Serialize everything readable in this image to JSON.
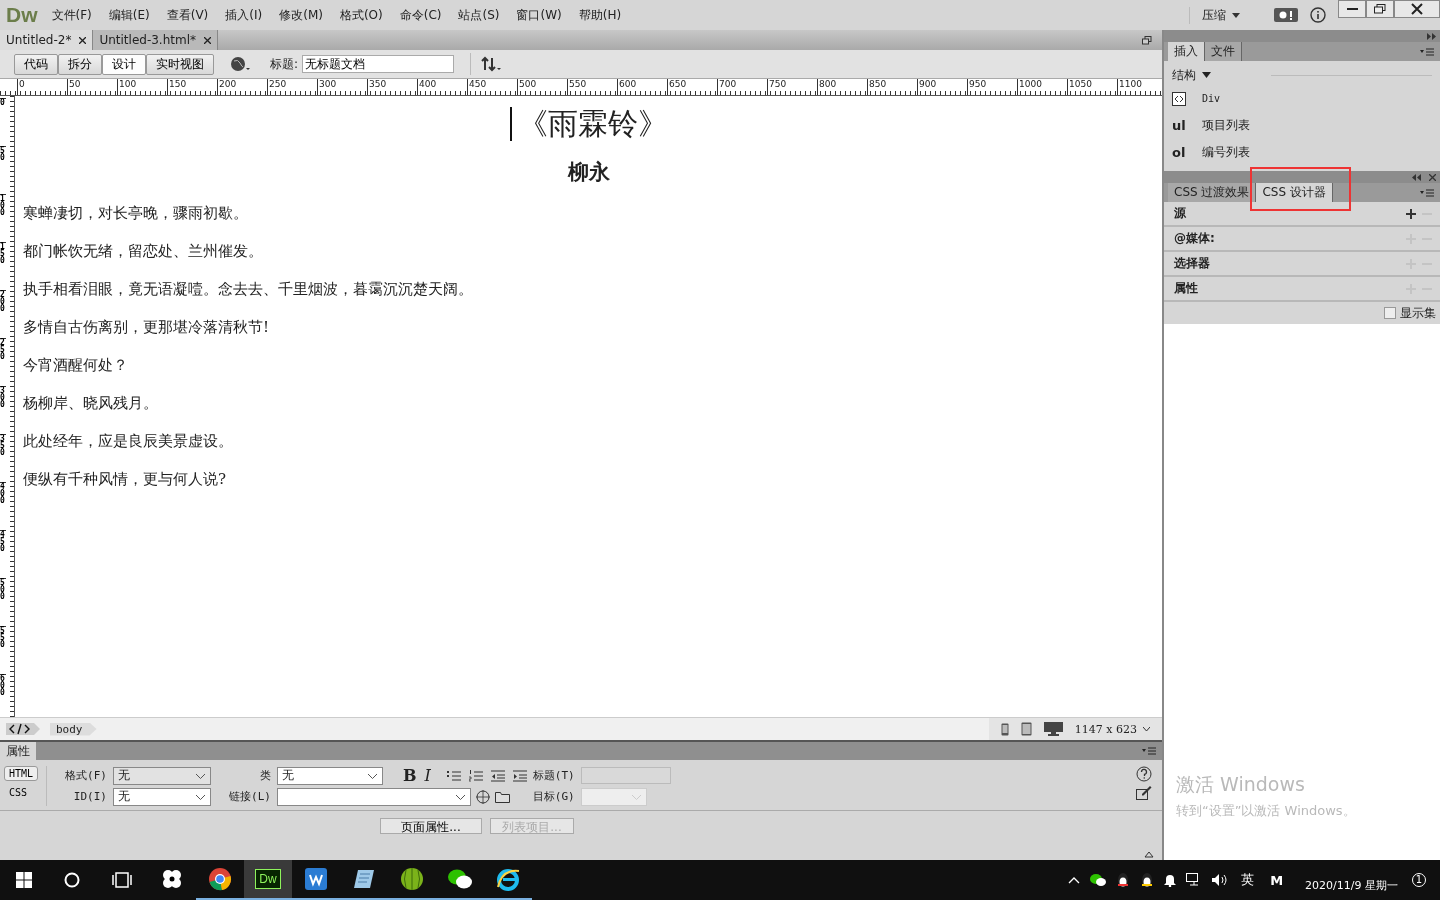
{
  "app": {
    "logo": "Dw",
    "menu": [
      "文件(F)",
      "编辑(E)",
      "查看(V)",
      "插入(I)",
      "修改(M)",
      "格式(O)",
      "命令(C)",
      "站点(S)",
      "窗口(W)",
      "帮助(H)"
    ],
    "workspace": "压缩"
  },
  "doc_tabs": [
    {
      "label": "Untitled-2*",
      "selected": true
    },
    {
      "label": "Untitled-3.html*",
      "selected": false
    }
  ],
  "toolbar": {
    "views": [
      {
        "label": "代码",
        "selected": false
      },
      {
        "label": "拆分",
        "selected": false
      },
      {
        "label": "设计",
        "selected": true
      },
      {
        "label": "实时视图",
        "selected": false
      }
    ],
    "title_label": "标题:",
    "title_value": "无标题文档"
  },
  "ruler": {
    "horizontal": [
      "0",
      "50",
      "100",
      "150",
      "200",
      "250",
      "300",
      "350",
      "400",
      "450",
      "500",
      "550",
      "600",
      "650",
      "700",
      "750",
      "800",
      "850",
      "900",
      "950",
      "1000",
      "1050",
      "1100"
    ],
    "vertical": [
      "0",
      "50",
      "100",
      "150",
      "200",
      "250",
      "300",
      "350",
      "400",
      "450",
      "500",
      "550",
      "600"
    ]
  },
  "document": {
    "title": "《雨霖铃》",
    "author": "柳永",
    "lines": [
      "寒蝉凄切，对长亭晚，骤雨初歇。",
      "都门帐饮无绪，留恋处、兰州催发。",
      "执手相看泪眼，竟无语凝噎。念去去、千里烟波，暮霭沉沉楚天阔。",
      "多情自古伤离别，更那堪冷落清秋节!",
      "今宵酒醒何处？",
      "杨柳岸、晓风残月。",
      "此处经年，应是良辰美景虚设。",
      "便纵有千种风情，更与何人说?"
    ]
  },
  "status_bar": {
    "tag": "body",
    "size": "1147 x 623"
  },
  "properties": {
    "title": "属性",
    "modes": [
      {
        "label": "HTML",
        "selected": true
      },
      {
        "label": "CSS",
        "selected": false
      }
    ],
    "bold": "B",
    "italic": "I",
    "format_label": "格式(F)",
    "format_value": "无",
    "id_label": "ID(I)",
    "id_value": "无",
    "class_label": "类",
    "class_value": "无",
    "link_label": "链接(L)",
    "heading_label": "标题(T)",
    "target_label": "目标(G)",
    "buttons": [
      {
        "label": "页面属性...",
        "disabled": false
      },
      {
        "label": "列表项目...",
        "disabled": true
      }
    ]
  },
  "insert_panel": {
    "tabs": [
      {
        "label": "插入",
        "selected": true
      },
      {
        "label": "文件",
        "selected": false
      }
    ],
    "category": "结构",
    "items": [
      {
        "kind": "div",
        "label": "Div"
      },
      {
        "kind": "text",
        "icon": "ul",
        "label": "项目列表"
      },
      {
        "kind": "text",
        "icon": "ol",
        "label": "编号列表"
      }
    ]
  },
  "css_panel": {
    "tabs": [
      {
        "label": "CSS 过渡效果",
        "selected": false
      },
      {
        "label": "CSS 设计器",
        "selected": true
      }
    ],
    "sections": [
      {
        "label": "源",
        "add_enabled": true
      },
      {
        "label": "@媒体:",
        "add_enabled": false
      },
      {
        "label": "选择器",
        "add_enabled": false
      },
      {
        "label": "属性",
        "add_enabled": false
      }
    ],
    "show_set": {
      "label": "显示集",
      "checked": false
    },
    "highlighted": true
  },
  "activation": {
    "title": "激活 Windows",
    "subtitle": "转到“设置”以激活 Windows。"
  },
  "taskbar": {
    "apps": [
      {
        "kind": "pinwheel",
        "selected": false,
        "running": false
      },
      {
        "kind": "chrome",
        "selected": false,
        "running": true
      },
      {
        "kind": "dw",
        "label": "Dw",
        "selected": true,
        "running": true
      },
      {
        "kind": "word",
        "selected": false,
        "running": true
      },
      {
        "kind": "notes",
        "selected": false,
        "running": true
      },
      {
        "kind": "melon",
        "selected": false,
        "running": true
      },
      {
        "kind": "wechat",
        "selected": false,
        "running": true
      },
      {
        "kind": "ie",
        "selected": false,
        "running": true
      }
    ],
    "ime": "英",
    "ime_mode": "M",
    "date": "2020/11/9 星期一",
    "notifications": "1"
  }
}
